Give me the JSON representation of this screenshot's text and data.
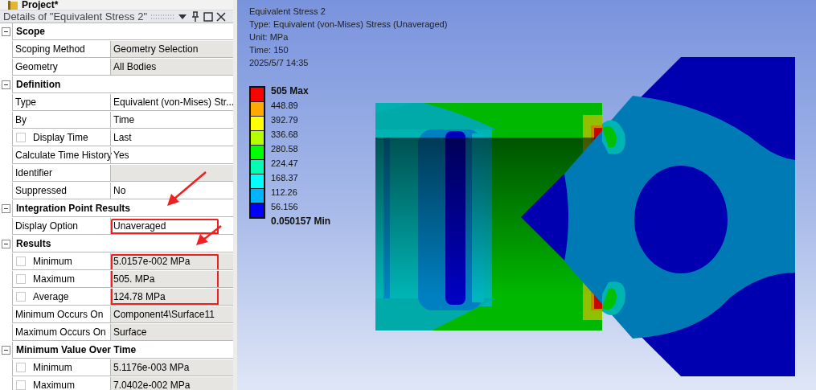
{
  "project_bar": {
    "title": "Project*"
  },
  "details": {
    "title": "Details of \"Equivalent Stress 2\"",
    "sections": [
      {
        "title": "Scope",
        "expanded": true,
        "rows": [
          {
            "kind": "plain",
            "label": "Scoping Method",
            "value": "Geometry Selection",
            "readonly": true
          },
          {
            "kind": "plain",
            "label": "Geometry",
            "value": "All Bodies",
            "readonly": true
          }
        ]
      },
      {
        "title": "Definition",
        "expanded": true,
        "rows": [
          {
            "kind": "plain",
            "label": "Type",
            "value": "Equivalent (von-Mises) Str...",
            "readonly": false
          },
          {
            "kind": "plain",
            "label": "By",
            "value": "Time",
            "readonly": false
          },
          {
            "kind": "checkbox",
            "checked": false,
            "label": "Display Time",
            "value": "Last",
            "readonly": false
          },
          {
            "kind": "plain",
            "label": "Calculate Time History",
            "value": "Yes",
            "readonly": false
          },
          {
            "kind": "plain",
            "label": "Identifier",
            "readonly": true
          },
          {
            "kind": "plain",
            "label": "Suppressed",
            "value": "No",
            "readonly": false
          }
        ]
      },
      {
        "title": "Integration Point Results",
        "expanded": true,
        "rows": [
          {
            "kind": "plain",
            "label": "Display Option",
            "value": "Unaveraged",
            "readonly": false,
            "highlighted": true
          }
        ]
      },
      {
        "title": "Results",
        "expanded": true,
        "rows": [
          {
            "kind": "checkbox",
            "checked": false,
            "label": "Minimum",
            "value": "5.0157e-002 MPa",
            "readonly": true,
            "highlighted": true
          },
          {
            "kind": "checkbox",
            "checked": false,
            "label": "Maximum",
            "value": "505. MPa",
            "readonly": true,
            "highlighted": true
          },
          {
            "kind": "checkbox",
            "checked": false,
            "label": "Average",
            "value": "124.78 MPa",
            "readonly": true,
            "highlighted": true
          },
          {
            "kind": "plain",
            "label": "Minimum Occurs On",
            "value": "Component4\\Surface11",
            "readonly": true
          },
          {
            "kind": "plain",
            "label": "Maximum Occurs On",
            "value": "Surface",
            "readonly": true
          }
        ]
      },
      {
        "title": "Minimum Value Over Time",
        "expanded": true,
        "rows": [
          {
            "kind": "checkbox",
            "checked": false,
            "label": "Minimum",
            "value": "5.1176e-003 MPa",
            "readonly": true
          },
          {
            "kind": "checkbox",
            "checked": false,
            "label": "Maximum",
            "value": "7.0402e-002 MPa",
            "readonly": true
          }
        ]
      }
    ]
  },
  "viewport": {
    "info_lines": [
      "Equivalent Stress 2",
      "Type: Equivalent (von-Mises) Stress (Unaveraged)",
      "Unit: MPa",
      "Time: 150",
      "2025/5/7 14:35"
    ],
    "legend": {
      "max_label": "505 Max",
      "min_label": "0.050157 Min",
      "ticks": [
        "448.89",
        "392.79",
        "336.68",
        "280.58",
        "224.47",
        "168.37",
        "112.26",
        "56.156"
      ],
      "bands": [
        {
          "color": "#ff0000"
        },
        {
          "color": "#ffaa00"
        },
        {
          "color": "#ffff00"
        },
        {
          "color": "#b4ff00"
        },
        {
          "color": "#00ff00"
        },
        {
          "color": "#00ffb4"
        },
        {
          "color": "#00ffff"
        },
        {
          "color": "#00b4ff"
        },
        {
          "color": "#0000ff"
        }
      ]
    }
  }
}
